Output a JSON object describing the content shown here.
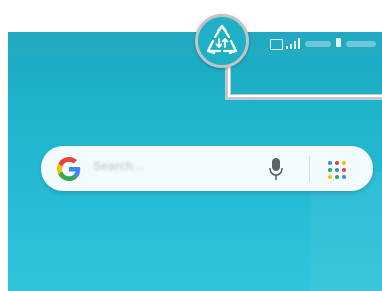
{
  "search": {
    "placeholder": "Search..."
  },
  "icons": {
    "badge": "recycle-data-saver-icon",
    "google": "google-g-icon",
    "mic": "microphone-icon",
    "apps": "app-grid-icon",
    "signal": "signal-strength-icon",
    "battery": "battery-icon"
  },
  "colors": {
    "wallpaper": "#1fb3cc",
    "badge_fill": "#1fb0c8",
    "callout_frame": "#c4c8c8",
    "google_blue": "#4285F4",
    "google_red": "#EA4335",
    "google_yellow": "#FBBC05",
    "google_green": "#34A853"
  }
}
